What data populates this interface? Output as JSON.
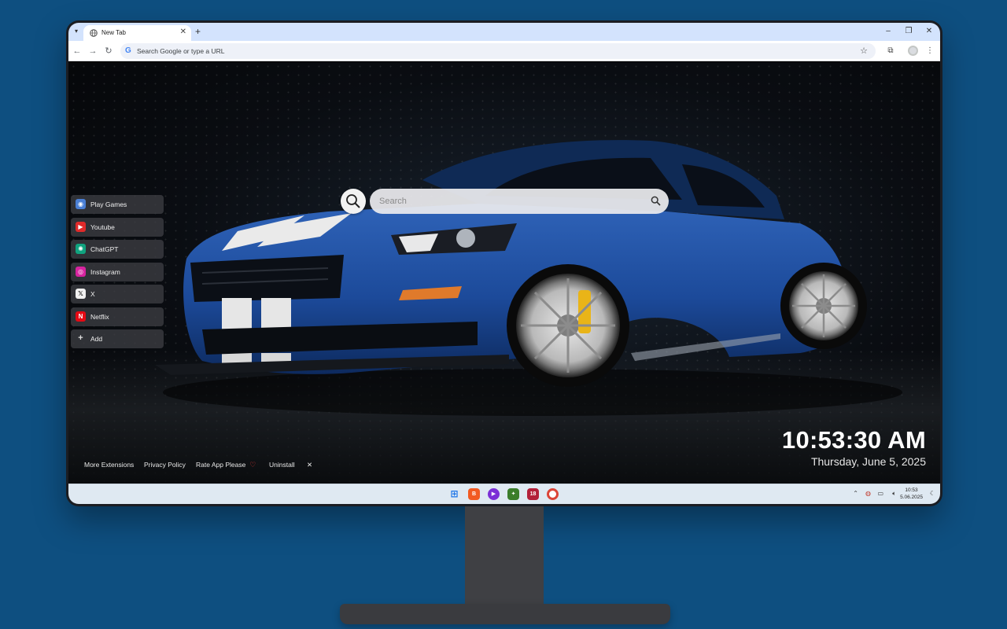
{
  "browser": {
    "tab_title": "New Tab",
    "omnibox_placeholder": "Search Google or type a URL"
  },
  "search": {
    "placeholder": "Search"
  },
  "shortcuts": [
    {
      "label": "Play Games",
      "icon": "gamepad-icon",
      "color": "#4a7fd4"
    },
    {
      "label": "Youtube",
      "icon": "youtube-icon",
      "color": "#e02a2a"
    },
    {
      "label": "ChatGPT",
      "icon": "chatgpt-icon",
      "color": "#10a37f"
    },
    {
      "label": "Instagram",
      "icon": "instagram-icon",
      "color": "#d6249f"
    },
    {
      "label": "X",
      "icon": "x-icon",
      "color": "#111111"
    },
    {
      "label": "Netflix",
      "icon": "netflix-icon",
      "color": "#e50914"
    },
    {
      "label": "Add",
      "icon": "plus-icon",
      "color": "#555555"
    }
  ],
  "footer": {
    "more_extensions": "More Extensions",
    "privacy_policy": "Privacy Policy",
    "rate_app": "Rate App Please",
    "uninstall": "Uninstall",
    "close": "✕"
  },
  "clock": {
    "time": "10:53:30 AM",
    "date": "Thursday, June 5, 2025"
  },
  "taskbar": {
    "time": "10:53",
    "date": "5.06.2025",
    "badge": "18"
  }
}
